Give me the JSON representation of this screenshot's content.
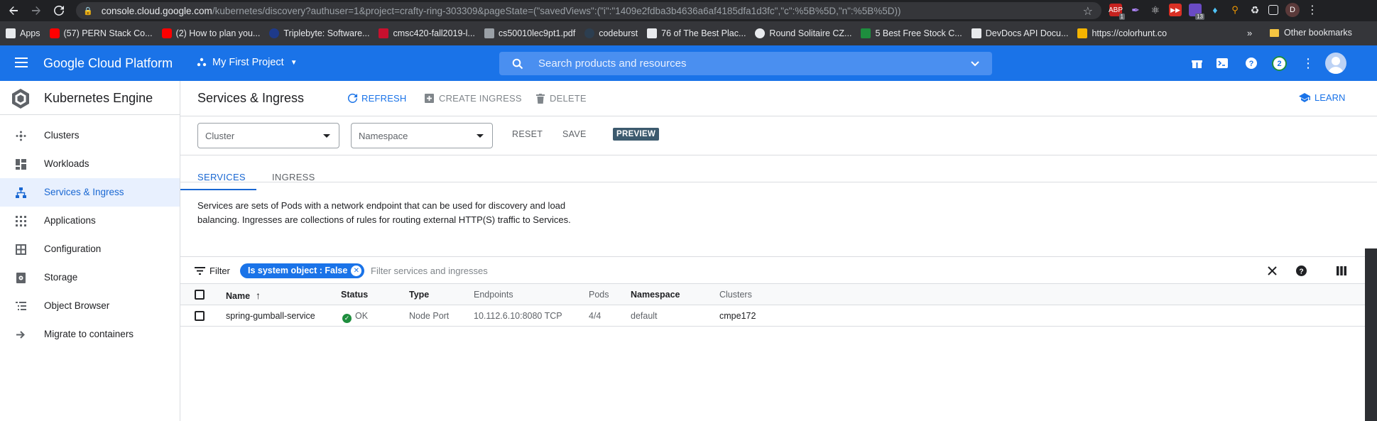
{
  "browser": {
    "url_host": "console.cloud.google.com",
    "url_rest": "/kubernetes/discovery?authuser=1&project=crafty-ring-303309&pageState=(\"savedViews\":(\"i\":\"1409e2fdba3b4636a6af4185dfa1d3fc\",\"c\":%5B%5D,\"n\":%5B%5D))",
    "profile_initial": "D",
    "ext_badge_1": "1",
    "ext_badge_2": "13"
  },
  "bookmarks": {
    "items": [
      {
        "label": "Apps",
        "color": "#5f6368"
      },
      {
        "label": "(57) PERN Stack Co...",
        "color": "#ff0000"
      },
      {
        "label": "(2) How to plan you...",
        "color": "#ff0000"
      },
      {
        "label": "Triplebyte: Software...",
        "color": "#1e3a8a"
      },
      {
        "label": "cmsc420-fall2019-l...",
        "color": "#c8102e"
      },
      {
        "label": "cs50010lec9pt1.pdf",
        "color": "#9aa0a6"
      },
      {
        "label": "codeburst",
        "color": "#2c3e50"
      },
      {
        "label": "76 of The Best Plac...",
        "color": "#e8eaed"
      },
      {
        "label": "Round Solitaire CZ...",
        "color": "#e8eaed"
      },
      {
        "label": "5 Best Free Stock C...",
        "color": "#1e8e3e"
      },
      {
        "label": "DevDocs API Docu...",
        "color": "#e8eaed"
      },
      {
        "label": "https://colorhunt.co",
        "color": "#f4b400"
      }
    ],
    "more": "»",
    "other": "Other bookmarks"
  },
  "header": {
    "title": "Google Cloud Platform",
    "project": "My First Project",
    "search_placeholder": "Search products and resources",
    "notifications": "2"
  },
  "sidebar": {
    "title": "Kubernetes Engine",
    "items": [
      {
        "label": "Clusters"
      },
      {
        "label": "Workloads"
      },
      {
        "label": "Services & Ingress"
      },
      {
        "label": "Applications"
      },
      {
        "label": "Configuration"
      },
      {
        "label": "Storage"
      },
      {
        "label": "Object Browser"
      },
      {
        "label": "Migrate to containers"
      }
    ]
  },
  "main": {
    "title": "Services & Ingress",
    "refresh": "REFRESH",
    "create_ingress": "CREATE INGRESS",
    "delete": "DELETE",
    "learn": "LEARN",
    "cluster_placeholder": "Cluster",
    "namespace_placeholder": "Namespace",
    "reset": "RESET",
    "save": "SAVE",
    "preview": "PREVIEW",
    "tabs": [
      {
        "label": "SERVICES"
      },
      {
        "label": "INGRESS"
      }
    ],
    "description": "Services are sets of Pods with a network endpoint that can be used for discovery and load balancing. Ingresses are collections of rules for routing external HTTP(S) traffic to Services.",
    "filter_label": "Filter",
    "filter_chip": "Is system object : False",
    "filter_placeholder": "Filter services and ingresses"
  },
  "table": {
    "headers": {
      "name": "Name",
      "status": "Status",
      "type": "Type",
      "endpoints": "Endpoints",
      "pods": "Pods",
      "namespace": "Namespace",
      "clusters": "Clusters"
    },
    "rows": [
      {
        "name": "spring-gumball-service",
        "status": "OK",
        "type": "Node Port",
        "endpoints": "10.112.6.10:8080 TCP",
        "pods": "4/4",
        "namespace": "default",
        "clusters": "cmpe172"
      }
    ]
  },
  "colors": {
    "brand_blue": "#1a73e8",
    "status_ok": "#1e8e3e",
    "preview_badge": "#3c5a6e"
  }
}
